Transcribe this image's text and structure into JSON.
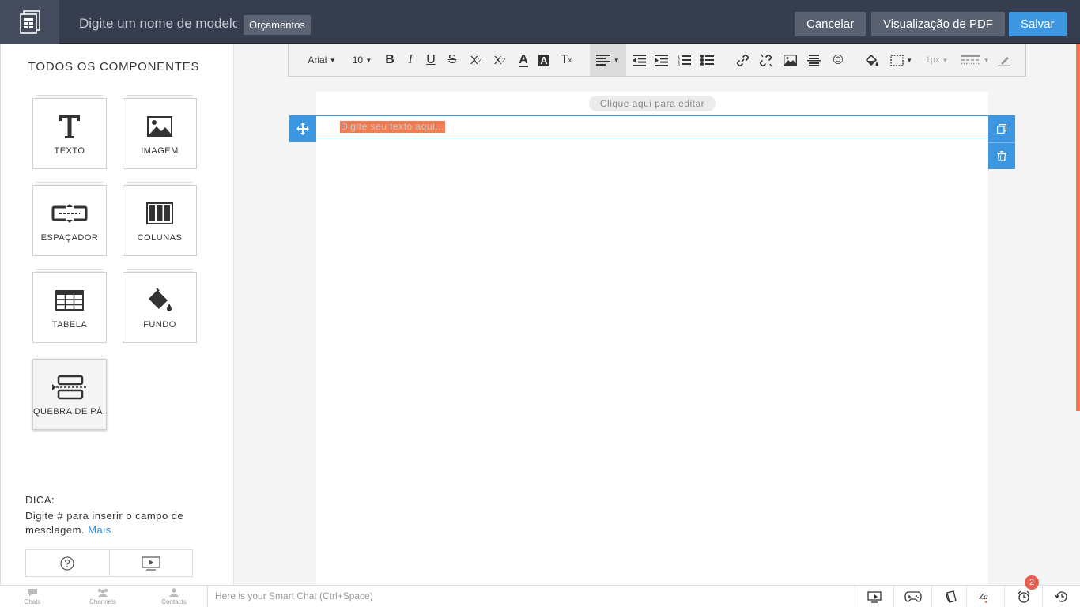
{
  "header": {
    "title_placeholder": "Digite um nome de modelo",
    "module_badge": "Orçamentos",
    "cancel_label": "Cancelar",
    "pdf_label": "Visualização de PDF",
    "save_label": "Salvar"
  },
  "sidebar": {
    "title": "TODOS OS COMPONENTES",
    "components": [
      {
        "label": "TEXTO",
        "icon": "text-icon"
      },
      {
        "label": "IMAGEM",
        "icon": "image-icon"
      },
      {
        "label": "ESPAÇADOR",
        "icon": "spacer-icon"
      },
      {
        "label": "COLUNAS",
        "icon": "columns-icon"
      },
      {
        "label": "TABELA",
        "icon": "table-icon"
      },
      {
        "label": "FUNDO",
        "icon": "background-icon"
      },
      {
        "label": "QUEBRA DE PÁ...",
        "icon": "page-break-icon"
      }
    ],
    "tip_heading": "DICA:",
    "tip_text": "Digite # para inserir o campo de mesclagem.",
    "tip_link": "Mais"
  },
  "toolbar": {
    "font": "Arial",
    "size": "10",
    "border_width": "1px"
  },
  "canvas": {
    "edit_hint": "Clique aqui para editar",
    "text_placeholder": "Digite seu texto aqui..."
  },
  "bottom": {
    "chats": "Chats",
    "channels": "Channels",
    "contacts": "Contacts",
    "smart_chat": "Here is your Smart Chat (Ctrl+Space)",
    "notif_count": "2"
  },
  "colors": {
    "accent": "#3d97e0",
    "header_bg": "#353d4e",
    "highlight": "#f07e52"
  }
}
